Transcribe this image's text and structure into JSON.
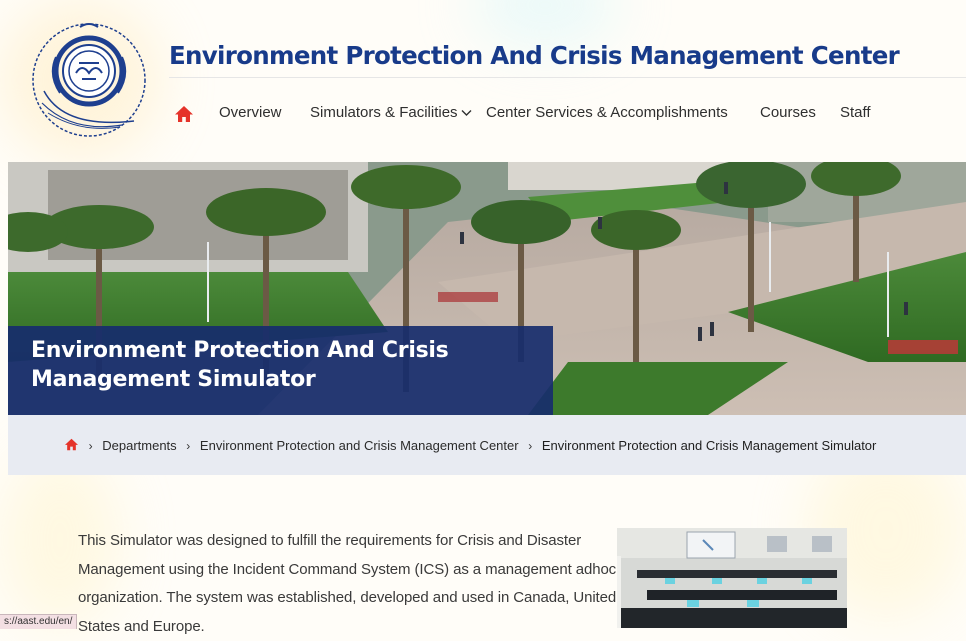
{
  "header": {
    "site_title": "Environment Protection And Crisis Management Center",
    "logo_icon": "aast-emblem-icon"
  },
  "nav": {
    "home_icon": "home-icon",
    "items": [
      {
        "label": "Overview"
      },
      {
        "label": "Simulators & Facilities",
        "has_dropdown": true
      },
      {
        "label": "Center Services & Accomplishments"
      },
      {
        "label": "Courses"
      },
      {
        "label": "Staff"
      }
    ]
  },
  "hero": {
    "title": "Environment Protection And Crisis Management Simulator"
  },
  "breadcrumb": {
    "home_icon": "home-icon",
    "items": [
      {
        "label": "Departments"
      },
      {
        "label": "Environment Protection and Crisis Management Center"
      }
    ],
    "current": "Environment Protection and Crisis Management Simulator"
  },
  "content": {
    "paragraph": "This Simulator was designed to fulfill the requirements for Crisis and Disaster Management using the Incident Command System (ICS) as a management adhoc organization. The system was established, developed and used in Canada, United States and Europe."
  },
  "status_bar": {
    "url": "s://aast.edu/en/"
  },
  "colors": {
    "brand_blue": "#183b8a",
    "hero_overlay": "#172d6c",
    "home_red": "#e5332a",
    "breadcrumb_bg": "#e8ebf2"
  }
}
